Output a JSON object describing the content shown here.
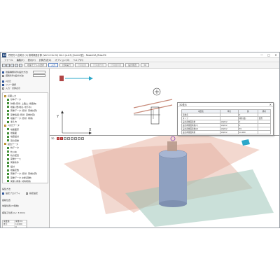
{
  "window": {
    "app_icon_text": "SI",
    "title": "貯槽方人出荷計 (0) 積荷構造計算 (Ver3.0 for SI) Ver.1 (a.b3) [Sumiri型] - RosaniSA_Rtao.ff4",
    "controls": [
      "—",
      "□",
      "✕"
    ]
  },
  "menu": [
    "ファイル",
    "編集(E)",
    "表示(V)",
    "計算方法(G)",
    "オプション(O)",
    "ヘルプ(H)"
  ],
  "toolbar": {
    "buttons": [
      {
        "label": "地盤モデルの選択",
        "state": "normal"
      },
      {
        "label": "入力",
        "state": "active"
      },
      {
        "label": "計算実行",
        "state": "normal"
      },
      {
        "label": "計算結果",
        "state": "disabled"
      },
      {
        "label": "計算書作成",
        "state": "disabled"
      },
      {
        "label": "計算書印刷",
        "state": "disabled"
      },
      {
        "label": "設計照査",
        "state": "normal"
      },
      {
        "label": "3D",
        "state": "normal"
      }
    ]
  },
  "left_panel": {
    "option_rows": [
      "地盤種類条件(設計方法)",
      "掘削条件(設計方法)",
      "2次元",
      "ツリー選択",
      "入力・計算表示"
    ],
    "sections": [
      "初期入力"
    ],
    "tree": [
      {
        "label": "初期入力",
        "kind": "folder"
      },
      {
        "label": "基本データ",
        "kind": "item"
      },
      {
        "label": "貯槽 (形状, 上載土, 構造物)",
        "kind": "item"
      },
      {
        "label": "地盤 (層/地表, 地下水)",
        "kind": "item"
      },
      {
        "label": "荷重データ (形状, 荷重計算)",
        "kind": "item"
      },
      {
        "label": "荷重情報 (形状, 荷重計算)",
        "kind": "item"
      },
      {
        "label": "地盤データ (形状, 荷重)",
        "kind": "item"
      },
      {
        "label": "考え方",
        "kind": "item"
      },
      {
        "label": "3次元データ",
        "kind": "folder"
      },
      {
        "label": "地盤面形",
        "kind": "item"
      },
      {
        "label": "地盤面",
        "kind": "item"
      },
      {
        "label": "地震設計",
        "kind": "item"
      },
      {
        "label": "荷の荷重",
        "kind": "item"
      },
      {
        "label": "結合データ",
        "kind": "folder"
      },
      {
        "label": "杭データ",
        "kind": "item"
      },
      {
        "label": "杭 (本)",
        "kind": "item"
      },
      {
        "label": "杭の配置",
        "kind": "item"
      },
      {
        "label": "荷重ケース",
        "kind": "item"
      },
      {
        "label": "荷重条件",
        "kind": "item"
      },
      {
        "label": "設計",
        "kind": "item"
      },
      {
        "label": "地盤定数",
        "kind": "item"
      },
      {
        "label": "荷重データ (形状, 荷重計算)",
        "kind": "item"
      },
      {
        "label": "荷重データ (材料荷重)",
        "kind": "item"
      },
      {
        "label": "荷重 (荷重, 材料荷重)",
        "kind": "item"
      }
    ],
    "bottom_labels": [
      "編集方法",
      "設定プロパティ",
      "指定設定",
      "掘削位置",
      "地盤位置(XY移動)",
      "補強工位置 (Lv: 3.00m)"
    ],
    "grid_header": [
      "荷重値",
      "荷重(m)"
    ],
    "grid_rows": [
      [
        "地下",
        "10.000"
      ],
      [
        "",
        "0"
      ],
      [
        "",
        "0"
      ]
    ]
  },
  "view3d": {
    "label": "3D"
  },
  "dialog": {
    "title": "3D表示",
    "close": "✕",
    "headers": [
      "項目名",
      "単位",
      "値",
      "備考"
    ],
    "rows": [
      [
        "荷重名",
        "",
        "0",
        ""
      ],
      [
        "タイプ",
        "",
        "荷重(面)",
        "矩形"
      ],
      [
        "設計荷重面荷重",
        "kN/m2",
        "0",
        ""
      ],
      [
        "設計荷重面荷重(Y)",
        "kN/m2",
        "0",
        ""
      ],
      [
        "設計荷重面荷重(Z)",
        "kN/m2",
        "39",
        ""
      ],
      [
        "設計荷重面荷重",
        "kN/m2",
        "10.000",
        ""
      ]
    ]
  },
  "axes": {
    "x": "X",
    "y": "Y"
  },
  "colors": {
    "tank": "#8ea0c0",
    "plane_a": "#e3aa98",
    "plane_b": "#9ec7b9",
    "marker": "#2aa7c9"
  }
}
